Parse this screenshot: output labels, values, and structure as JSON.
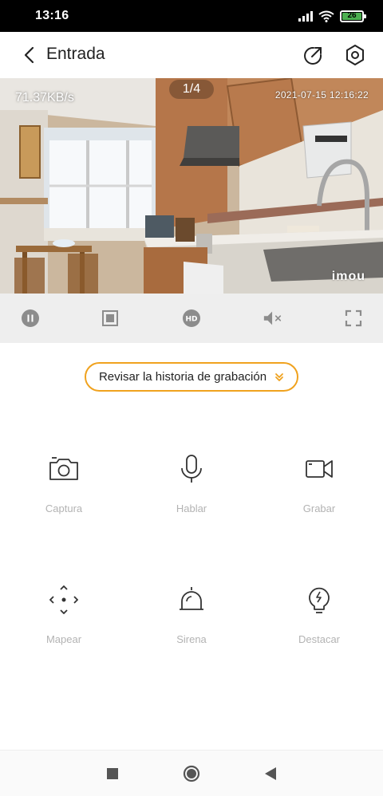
{
  "status_bar": {
    "time": "13:16",
    "battery": "26",
    "icons": [
      "signal-icon",
      "wifi-icon",
      "battery-icon"
    ]
  },
  "header": {
    "title": "Entrada",
    "icons": [
      "back-arrow-icon",
      "share-icon",
      "settings-icon"
    ]
  },
  "video": {
    "speed": "71.37KB/s",
    "page_indicator": "1/4",
    "timestamp": "2021-07-15 12:16:22",
    "logo": "imou"
  },
  "controls": [
    "pause-icon",
    "stop-icon",
    "hd-icon",
    "mute-icon",
    "fullscreen-icon"
  ],
  "history_button": {
    "label": "Revisar la historia de grabación"
  },
  "actions": [
    {
      "label": "Captura",
      "icon": "camera-icon"
    },
    {
      "label": "Hablar",
      "icon": "microphone-icon"
    },
    {
      "label": "Grabar",
      "icon": "video-record-icon"
    },
    {
      "label": "Mapear",
      "icon": "pan-tilt-icon"
    },
    {
      "label": "Sirena",
      "icon": "siren-icon"
    },
    {
      "label": "Destacar",
      "icon": "light-bulb-icon"
    }
  ],
  "nav_bar": [
    "recents-icon",
    "home-icon",
    "back-icon"
  ],
  "colors": {
    "accent": "#f0a21e",
    "battery": "#4caf50",
    "control_icon": "#888888",
    "action_label": "#b3b3b3"
  }
}
